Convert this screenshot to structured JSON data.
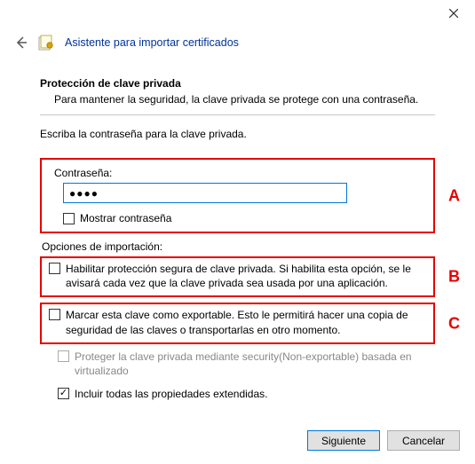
{
  "window": {
    "title": "Asistente para importar certificados"
  },
  "section": {
    "heading": "Protección de clave privada",
    "description": "Para mantener la seguridad, la clave privada se protege con una contraseña."
  },
  "instruction": "Escriba la contraseña para la clave privada.",
  "password": {
    "label": "Contraseña:",
    "value": "●●●●",
    "show_label": "Mostrar contraseña"
  },
  "import_options": {
    "group_label": "Opciones de importación:",
    "enable_strong": "Habilitar protección segura de clave privada. Si habilita esta opción, se le avisará cada vez que la clave privada sea usada por una aplicación.",
    "mark_exportable": "Marcar esta clave como exportable. Esto le permitirá hacer una copia de seguridad de las claves o transportarlas en otro momento.",
    "protect_virtual": "Proteger la clave privada mediante security(Non-exportable) basada en virtualizado",
    "include_ext": "Incluir todas las propiedades extendidas."
  },
  "annotations": {
    "a": "A",
    "b": "B",
    "c": "C"
  },
  "buttons": {
    "next": "Siguiente",
    "cancel": "Cancelar"
  },
  "colors": {
    "highlight": "#e60000",
    "accent": "#0078d7"
  }
}
